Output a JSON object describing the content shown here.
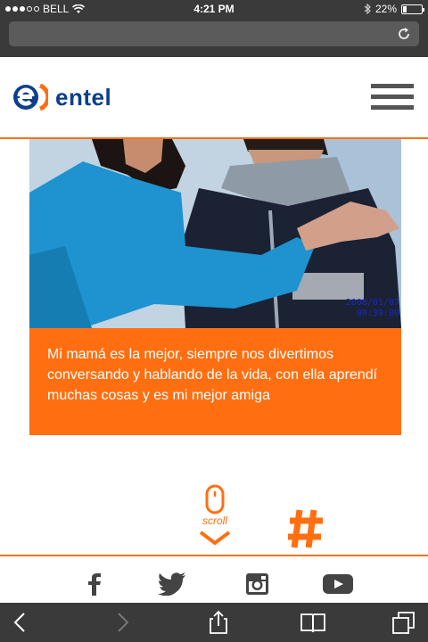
{
  "status_bar": {
    "carrier": "BELL",
    "time": "4:21 PM",
    "battery": "22%",
    "battery_level": 0.22
  },
  "header": {
    "logo_text": "entel",
    "brand_color": "#ff6f12",
    "logo_color": "#0c3f8c",
    "menu_icon": "hamburger-icon"
  },
  "photo": {
    "stamp_line1": "2008/01/07",
    "stamp_line2": "00:39:00"
  },
  "caption": {
    "text": "Mi mamá es la mejor, siempre nos divertimos conversando y hablando de la vida, con ella aprendí muchas cosas y es mi mejor amiga"
  },
  "scroll": {
    "label": "scroll"
  },
  "social": {
    "icons": [
      "facebook-icon",
      "twitter-icon",
      "instagram-icon",
      "youtube-icon"
    ]
  },
  "toolbar": {
    "icons": [
      "back-icon",
      "forward-icon",
      "share-icon",
      "bookmarks-icon",
      "tabs-icon"
    ]
  }
}
